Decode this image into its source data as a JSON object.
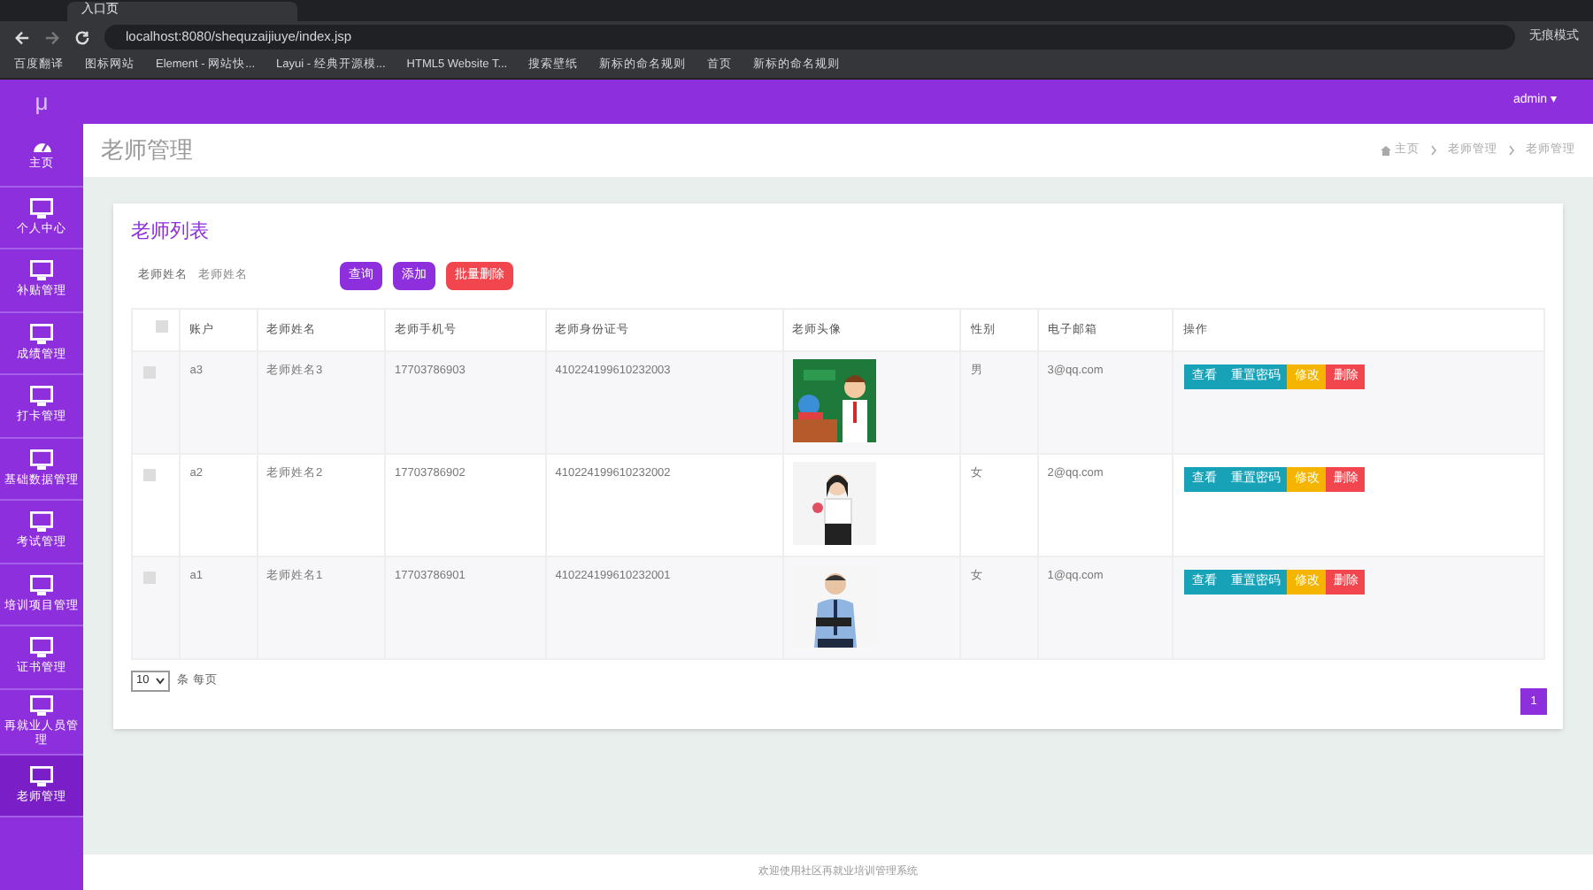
{
  "browser": {
    "tab_title": "入口页",
    "url": "localhost:8080/shequzaijiuye/index.jsp",
    "profile": "无痕模式",
    "bookmarks": [
      "百度翻译",
      "图标网站",
      "Element - 网站快...",
      "Layui - 经典开源模...",
      "HTML5 Website T...",
      "搜索壁纸",
      "新标的命名规则",
      "首页",
      "新标的命名规则"
    ]
  },
  "app": {
    "logo": "μ",
    "user": "admin ▾"
  },
  "sidebar": {
    "items": [
      {
        "label": "主页",
        "kind": "dashboard",
        "selected": false
      },
      {
        "label": "个人中心",
        "kind": "monitor",
        "selected": false
      },
      {
        "label": "补贴管理",
        "kind": "monitor",
        "selected": false
      },
      {
        "label": "成绩管理",
        "kind": "monitor",
        "selected": false
      },
      {
        "label": "打卡管理",
        "kind": "monitor",
        "selected": false
      },
      {
        "label": "基础数据管理",
        "kind": "monitor",
        "selected": false
      },
      {
        "label": "考试管理",
        "kind": "monitor",
        "selected": false
      },
      {
        "label": "培训项目管理",
        "kind": "monitor",
        "selected": false
      },
      {
        "label": "证书管理",
        "kind": "monitor",
        "selected": false
      },
      {
        "label": "再就业人员管理",
        "kind": "monitor",
        "selected": false
      },
      {
        "label": "老师管理",
        "kind": "monitor",
        "selected": true
      }
    ]
  },
  "page": {
    "title": "老师管理",
    "breadcrumb": [
      "主页",
      "老师管理",
      "老师管理"
    ]
  },
  "card": {
    "title": "老师列表",
    "search": {
      "label": "老师姓名",
      "placeholder": "老师姓名"
    },
    "buttons": [
      "查询",
      "添加",
      "批量删除"
    ],
    "table": {
      "select_all_checked": false,
      "columns": [
        "账户",
        "老师姓名",
        "老师手机号",
        "老师身份证号",
        "老师头像",
        "性别",
        "电子邮箱",
        "操作"
      ],
      "rows": [
        {
          "checked": false,
          "account": "a3",
          "name": "老师姓名3",
          "phone": "17703786903",
          "id_number": "410224199610232003",
          "gender": "男",
          "email": "3@qq.com",
          "actions": [
            "查看",
            "重置密码",
            "修改",
            "删除"
          ]
        },
        {
          "checked": false,
          "account": "a2",
          "name": "老师姓名2",
          "phone": "17703786902",
          "id_number": "410224199610232002",
          "gender": "女",
          "email": "2@qq.com",
          "actions": [
            "查看",
            "重置密码",
            "修改",
            "删除"
          ]
        },
        {
          "checked": false,
          "account": "a1",
          "name": "老师姓名1",
          "phone": "17703786901",
          "id_number": "410224199610232001",
          "gender": "女",
          "email": "1@qq.com",
          "actions": [
            "查看",
            "重置密码",
            "修改",
            "删除"
          ]
        }
      ]
    },
    "page_size": "10",
    "page_size_suffix": "条 每页",
    "pages": [
      {
        "label": "1",
        "selected": true
      }
    ]
  },
  "footer": "欢迎使用社区再就业培训管理系统"
}
